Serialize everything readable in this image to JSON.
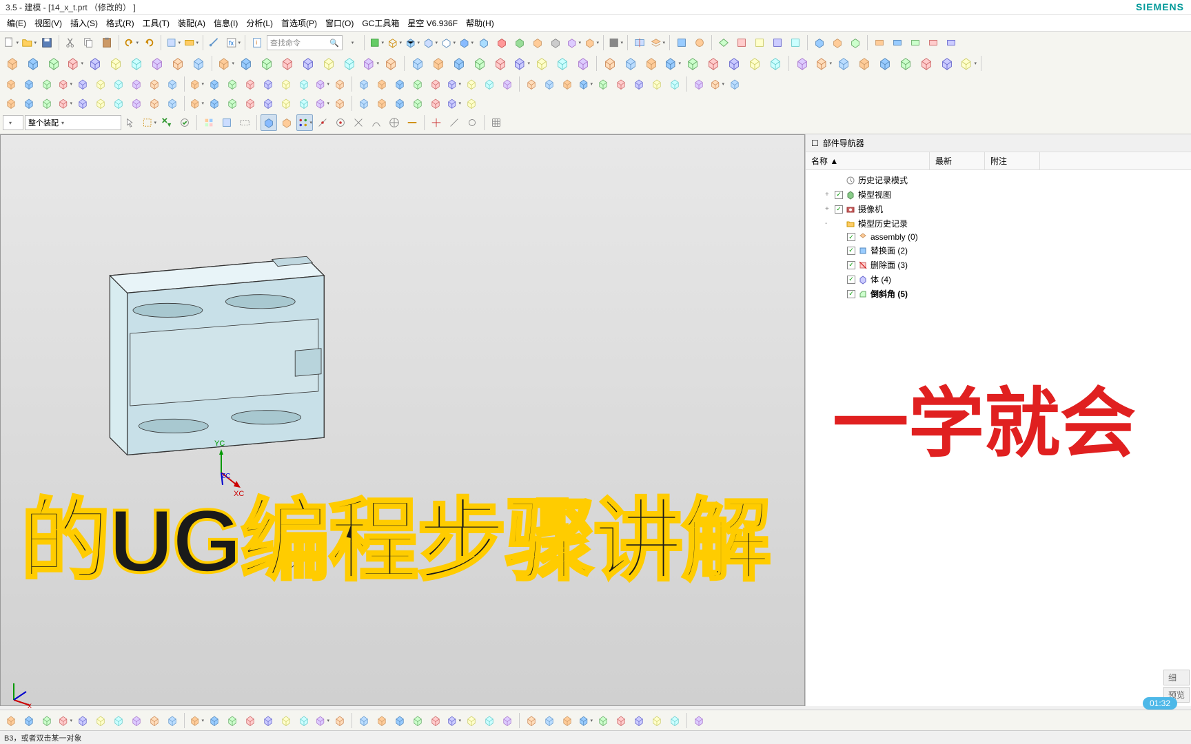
{
  "title": "3.5 - 建模 - [14_x_t.prt （修改的） ]",
  "brand": "SIEMENS",
  "menu": [
    "编(E)",
    "视图(V)",
    "插入(S)",
    "格式(R)",
    "工具(T)",
    "装配(A)",
    "信息(I)",
    "分析(L)",
    "首选项(P)",
    "窗口(O)",
    "GC工具箱",
    "星空  V6.936F",
    "帮助(H)"
  ],
  "search_placeholder": "查找命令",
  "assembly_combo": "整个装配",
  "nav": {
    "title": "部件导航器",
    "cols": [
      "名称  ▲",
      "最新",
      "附注"
    ],
    "items": [
      {
        "indent": 0,
        "exp": "",
        "chk": "",
        "icon": "clock",
        "label": "历史记录模式",
        "check": ""
      },
      {
        "indent": 0,
        "exp": "+",
        "chk": "✓",
        "icon": "cube-g",
        "label": "模型视图",
        "check": ""
      },
      {
        "indent": 0,
        "exp": "+",
        "chk": "✓",
        "icon": "camera",
        "label": "摄像机",
        "check": ""
      },
      {
        "indent": 0,
        "exp": "-",
        "chk": "",
        "icon": "folder",
        "label": "模型历史记录",
        "check": ""
      },
      {
        "indent": 1,
        "exp": "",
        "chk": "✓",
        "icon": "asm",
        "label": "assembly (0)",
        "check": "✓"
      },
      {
        "indent": 1,
        "exp": "",
        "chk": "✓",
        "icon": "face",
        "label": "替换面 (2)",
        "check": "✓"
      },
      {
        "indent": 1,
        "exp": "",
        "chk": "✓",
        "icon": "delface",
        "label": "删除面 (3)",
        "check": "✓"
      },
      {
        "indent": 1,
        "exp": "",
        "chk": "✓",
        "icon": "body",
        "label": "体 (4)",
        "check": "✓"
      },
      {
        "indent": 1,
        "exp": "",
        "chk": "✓",
        "icon": "chamfer",
        "label": "倒斜角 (5)",
        "check": "✓",
        "bold": true
      }
    ]
  },
  "axis": {
    "x": "XC",
    "y": "YC",
    "z": "ZC"
  },
  "overlay1": "一学就会",
  "overlay2": "的UG编程步骤讲解",
  "status": "B3，或者双击某一对象",
  "preview_tab": "预览",
  "detail_tab": "细",
  "timer": "01:32"
}
